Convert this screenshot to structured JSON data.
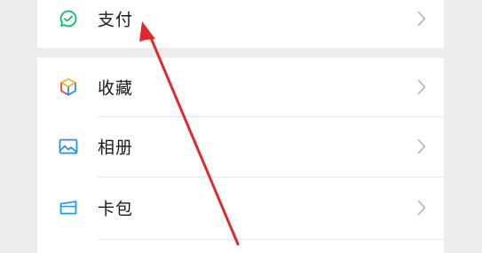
{
  "menu": {
    "payment": {
      "label": "支付",
      "icon": "payment-icon"
    },
    "items": [
      {
        "label": "收藏",
        "icon": "favorites-icon"
      },
      {
        "label": "相册",
        "icon": "album-icon"
      },
      {
        "label": "卡包",
        "icon": "card-wallet-icon"
      }
    ]
  },
  "colors": {
    "background": "#ededed",
    "card": "#ffffff",
    "payment_green": "#07c160",
    "album_blue": "#2c8fe8",
    "card_blue": "#1aa0e8",
    "annotation_arrow": "#e0282f",
    "chevron": "#b2b2b2"
  }
}
